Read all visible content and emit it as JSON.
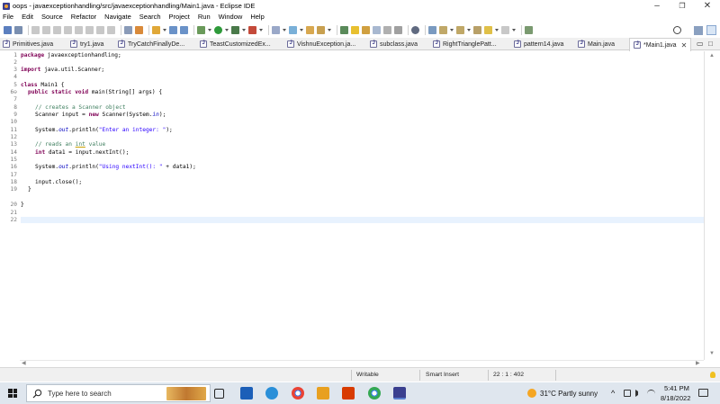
{
  "window": {
    "title": "oops - javaexceptionhandling/src/javaexceptionhandling/Main1.java - Eclipse IDE",
    "minimize": "–",
    "maximize": "❐",
    "close": "✕"
  },
  "menus": [
    "File",
    "Edit",
    "Source",
    "Refactor",
    "Navigate",
    "Search",
    "Project",
    "Run",
    "Window",
    "Help"
  ],
  "tabs": [
    {
      "label": "Primitives.java",
      "active": false
    },
    {
      "label": "try1.java",
      "active": false
    },
    {
      "label": "TryCatchFinallyDe...",
      "active": false
    },
    {
      "label": "TeastCustomizedEx...",
      "active": false
    },
    {
      "label": "VishnuException.ja...",
      "active": false
    },
    {
      "label": "subclass.java",
      "active": false
    },
    {
      "label": "RightTrianglePatt...",
      "active": false
    },
    {
      "label": "pattern14.java",
      "active": false
    },
    {
      "label": "Main.java",
      "active": false
    },
    {
      "label": "*Main1.java",
      "active": true
    }
  ],
  "tab_close": "✕",
  "view_controls": {
    "minimize": "▭",
    "maximize": "□"
  },
  "code": {
    "line_numbers": [
      "1",
      "2",
      "3",
      "4",
      "5",
      "6⊖",
      "7",
      "8",
      "9",
      "10",
      "11",
      "12",
      "13",
      "14",
      "15",
      "16",
      "17",
      "18",
      "19",
      "20",
      "21",
      "22"
    ],
    "lines": {
      "l1_kw": "package",
      "l1_rest": " javaexceptionhandling;",
      "l3_kw": "import",
      "l3_rest": " java.util.Scanner;",
      "l5_kw": "class",
      "l5_rest": " Main1 {",
      "l6_kw1": "public",
      "l6_kw2": "static",
      "l6_kw3": "void",
      "l6_rest": " main(String[] args) {",
      "l8_cm": "// creates a Scanner object",
      "l9_a": "Scanner input = ",
      "l9_kw": "new",
      "l9_b": " Scanner(System.",
      "l9_fld": "in",
      "l9_c": ");",
      "l11_a": "System.",
      "l11_fld": "out",
      "l11_b": ".println(",
      "l11_str": "\"Enter an integer: \"",
      "l11_c": ");",
      "l13_cm1": "// reads an ",
      "l13_ul": "int",
      "l13_cm2": " value",
      "l14_kw": "int",
      "l14_rest": " data1 = input.nextInt();",
      "l16_a": "System.",
      "l16_fld": "out",
      "l16_b": ".println(",
      "l16_str": "\"Using nextInt(): \"",
      "l16_c": " + data1);",
      "l18": "input.close();",
      "l19": "}",
      "l20": "}"
    }
  },
  "status": {
    "writable": "Writable",
    "insert_mode": "Smart Insert",
    "position": "22 : 1 : 402"
  },
  "taskbar": {
    "search_placeholder": "Type here to search",
    "weather": "31°C  Partly sunny",
    "time": "5:41 PM",
    "date": "8/18/2022",
    "tray_caret": "^"
  }
}
